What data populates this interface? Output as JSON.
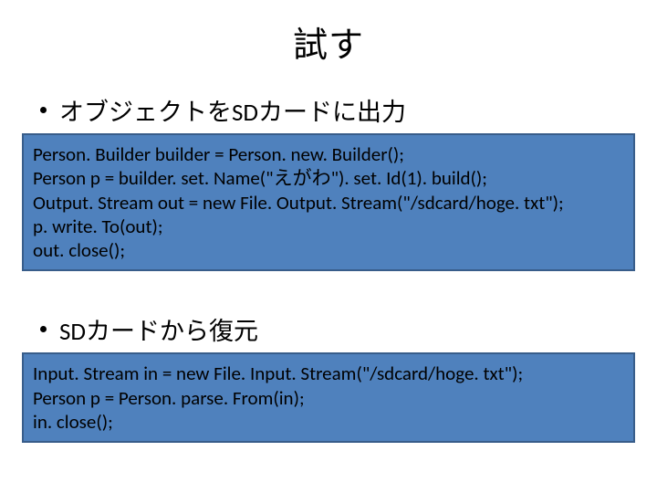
{
  "title": "試す",
  "bullets": {
    "b1": "オブジェクトをSDカードに出力",
    "b2": "SDカードから復元"
  },
  "code1": {
    "l1": "Person. Builder builder = Person. new. Builder();",
    "l2": "Person p = builder. set. Name(\"えがわ\"). set. Id(1). build();",
    "l3": "Output. Stream out = new File. Output. Stream(\"/sdcard/hoge. txt\");",
    "l4": "p. write. To(out);",
    "l5": "out. close();"
  },
  "code2": {
    "l1": "Input. Stream in = new File. Input. Stream(\"/sdcard/hoge. txt\");",
    "l2": "Person p = Person. parse. From(in);",
    "l3": "in. close();"
  }
}
